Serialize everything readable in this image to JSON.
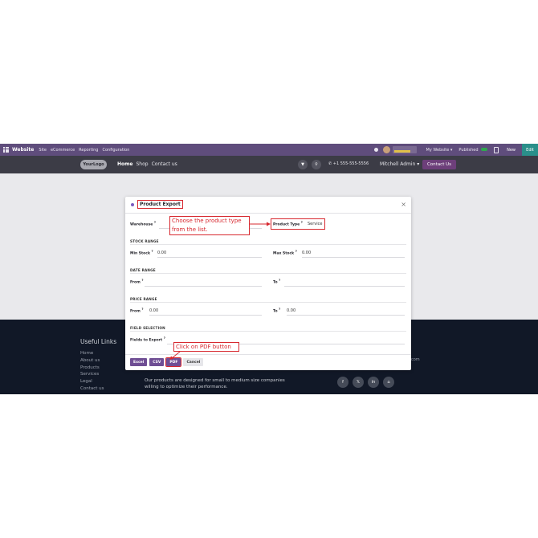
{
  "topbar": {
    "app": "Website",
    "menus": [
      "Site",
      "eCommerce",
      "Reporting",
      "Configuration"
    ],
    "website_selector": "My Website",
    "published_label": "Published",
    "new_label": "New",
    "edit_label": "Edit"
  },
  "header": {
    "logo_text": "YourLogo",
    "nav": [
      "Home",
      "Shop",
      "Contact us"
    ],
    "phone": "+1 555-555-5556",
    "user": "Mitchell Admin",
    "contact_button": "Contact Us"
  },
  "footer": {
    "useful_links_title": "Useful Links",
    "links": [
      "Home",
      "About us",
      "Products",
      "Services",
      "Legal",
      "Contact us"
    ],
    "about_text": "Our products are designed for small to medium size companies willing to optimize their performance.",
    "stray_text": "com",
    "socials": [
      "f",
      "𝕏",
      "in",
      "⌂"
    ]
  },
  "modal": {
    "title": "Product Export",
    "close": "×",
    "warehouse_label": "Warehouse",
    "product_type_label": "Product Type",
    "product_type_value": "Service",
    "stock_range": "STOCK RANGE",
    "min_stock_label": "Min Stock",
    "min_stock_value": "0.00",
    "max_stock_label": "Max Stock",
    "max_stock_value": "0.00",
    "date_range": "DATE RANGE",
    "from_label": "From",
    "to_label": "To",
    "price_range": "PRICE RANGE",
    "price_from_label": "From",
    "price_from_value": "0.00",
    "price_to_label": "To",
    "price_to_value": "0.00",
    "field_selection": "FIELD SELECTION",
    "fields_to_export_label": "Fields to Export",
    "buttons": {
      "excel": "Excel",
      "csv": "CSV",
      "pdf": "PDF",
      "cancel": "Cancel"
    },
    "help_marker": "?"
  },
  "annotations": {
    "product_type_note": "Choose the product type from the list.",
    "pdf_note": "Click on PDF button"
  },
  "colors": {
    "accent": "#6f4e94",
    "annotation": "#d7282f",
    "topbar": "#5f4d7c",
    "footer": "#111827"
  }
}
